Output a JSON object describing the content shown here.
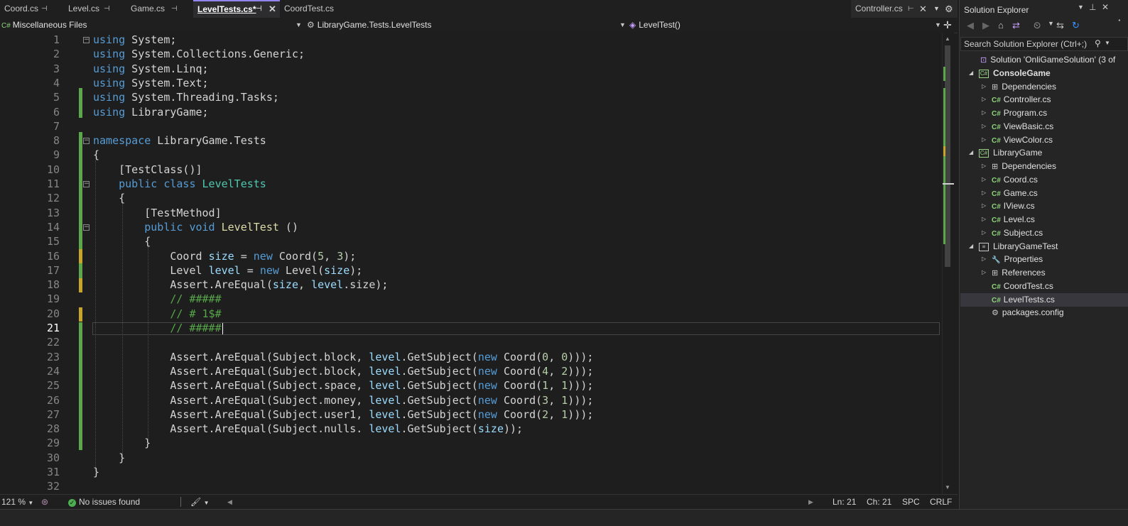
{
  "tabs": [
    {
      "label": "Coord.cs",
      "pinned": true
    },
    {
      "label": "Level.cs",
      "pinned": true
    },
    {
      "label": "Game.cs",
      "pinned": true
    },
    {
      "label": "LevelTests.cs*",
      "pinned": true,
      "active": true
    },
    {
      "label": "CoordTest.cs"
    }
  ],
  "right_tab": {
    "label": "Controller.cs"
  },
  "nav": {
    "project": "Miscellaneous Files",
    "class": "LibraryGame.Tests.LevelTests",
    "member": "LevelTest()"
  },
  "editor": {
    "lines": [
      {
        "n": "1",
        "html": "<span class=\"kw\">using</span> System;"
      },
      {
        "n": "2",
        "html": "<span class=\"kw\">using</span> System.Collections.Generic;"
      },
      {
        "n": "3",
        "html": "<span class=\"kw\">using</span> System.Linq;"
      },
      {
        "n": "4",
        "html": "<span class=\"kw\">using</span> System.Text;"
      },
      {
        "n": "5",
        "html": "<span class=\"kw\">using</span> System.Threading.Tasks;"
      },
      {
        "n": "6",
        "html": "<span class=\"kw\">using</span> LibraryGame;"
      },
      {
        "n": "7",
        "html": ""
      },
      {
        "n": "8",
        "html": "<span class=\"kw\">namespace</span> LibraryGame.Tests"
      },
      {
        "n": "9",
        "html": "{"
      },
      {
        "n": "10",
        "html": "    [TestClass()]"
      },
      {
        "n": "11",
        "html": "    <span class=\"kw\">public</span> <span class=\"kw\">class</span> <span class=\"ty\">LevelTests</span>"
      },
      {
        "n": "12",
        "html": "    {"
      },
      {
        "n": "13",
        "html": "        [TestMethod]"
      },
      {
        "n": "14",
        "html": "        <span class=\"kw\">public</span> <span class=\"kw\">void</span> <span class=\"fn\">LevelTest</span> ()"
      },
      {
        "n": "15",
        "html": "        {"
      },
      {
        "n": "16",
        "html": "            Coord <span class=\"va\">size</span> = <span class=\"kw\">new</span> Coord(<span class=\"nu\">5</span>, <span class=\"nu\">3</span>);"
      },
      {
        "n": "17",
        "html": "            Level <span class=\"va\">level</span> = <span class=\"kw\">new</span> Level(<span class=\"va\">size</span>);"
      },
      {
        "n": "18",
        "html": "            Assert.AreEqual(<span class=\"va\">size</span>, <span class=\"va\">level</span>.size);"
      },
      {
        "n": "19",
        "html": "            <span class=\"cm\">// #####</span>"
      },
      {
        "n": "20",
        "html": "            <span class=\"cm\">// # 1$#</span>"
      },
      {
        "n": "21",
        "html": "            <span class=\"cm\">// #####</span>"
      },
      {
        "n": "22",
        "html": ""
      },
      {
        "n": "23",
        "html": "            Assert.AreEqual(Subject.block, <span class=\"va\">level</span>.GetSubject(<span class=\"kw\">new</span> Coord(<span class=\"nu\">0</span>, <span class=\"nu\">0</span>)));"
      },
      {
        "n": "24",
        "html": "            Assert.AreEqual(Subject.block, <span class=\"va\">level</span>.GetSubject(<span class=\"kw\">new</span> Coord(<span class=\"nu\">4</span>, <span class=\"nu\">2</span>)));"
      },
      {
        "n": "25",
        "html": "            Assert.AreEqual(Subject.space, <span class=\"va\">level</span>.GetSubject(<span class=\"kw\">new</span> Coord(<span class=\"nu\">1</span>, <span class=\"nu\">1</span>)));"
      },
      {
        "n": "26",
        "html": "            Assert.AreEqual(Subject.money, <span class=\"va\">level</span>.GetSubject(<span class=\"kw\">new</span> Coord(<span class=\"nu\">3</span>, <span class=\"nu\">1</span>)));"
      },
      {
        "n": "27",
        "html": "            Assert.AreEqual(Subject.user1, <span class=\"va\">level</span>.GetSubject(<span class=\"kw\">new</span> Coord(<span class=\"nu\">2</span>, <span class=\"nu\">1</span>)));"
      },
      {
        "n": "28",
        "html": "            Assert.AreEqual(Subject.nulls. <span class=\"va\">level</span>.GetSubject(<span class=\"va\">size</span>));"
      },
      {
        "n": "29",
        "html": "        }"
      },
      {
        "n": "30",
        "html": "    }"
      },
      {
        "n": "31",
        "html": "}"
      },
      {
        "n": "32",
        "html": ""
      }
    ],
    "current_line": "21"
  },
  "status": {
    "zoom": "121 %",
    "issues": "No issues found",
    "ln": "Ln: 21",
    "ch": "Ch: 21",
    "spc": "SPC",
    "crlf": "CRLF"
  },
  "solution_explorer": {
    "title": "Solution Explorer",
    "search_placeholder": "Search Solution Explorer (Ctrl+;)",
    "items": [
      {
        "label": "Solution 'OnliGameSolution' (3 of",
        "kind": "solution",
        "level": 0
      },
      {
        "label": "ConsoleGame",
        "kind": "project",
        "level": 1,
        "bold": true,
        "expanded": true
      },
      {
        "label": "Dependencies",
        "kind": "deps",
        "level": 2
      },
      {
        "label": "Controller.cs",
        "kind": "cs",
        "level": 2
      },
      {
        "label": "Program.cs",
        "kind": "cs",
        "level": 2
      },
      {
        "label": "ViewBasic.cs",
        "kind": "cs",
        "level": 2
      },
      {
        "label": "ViewColor.cs",
        "kind": "cs",
        "level": 2
      },
      {
        "label": "LibraryGame",
        "kind": "project",
        "level": 1,
        "expanded": true
      },
      {
        "label": "Dependencies",
        "kind": "deps",
        "level": 2
      },
      {
        "label": "Coord.cs",
        "kind": "cs",
        "level": 2
      },
      {
        "label": "Game.cs",
        "kind": "cs",
        "level": 2
      },
      {
        "label": "IView.cs",
        "kind": "cs",
        "level": 2
      },
      {
        "label": "Level.cs",
        "kind": "cs",
        "level": 2
      },
      {
        "label": "Subject.cs",
        "kind": "cs",
        "level": 2
      },
      {
        "label": "LibraryGameTest",
        "kind": "testproject",
        "level": 1,
        "expanded": true
      },
      {
        "label": "Properties",
        "kind": "props",
        "level": 2
      },
      {
        "label": "References",
        "kind": "deps",
        "level": 2
      },
      {
        "label": "CoordTest.cs",
        "kind": "cs",
        "level": 2,
        "noarrow": true
      },
      {
        "label": "LevelTests.cs",
        "kind": "cs",
        "level": 2,
        "noarrow": true,
        "selected": true
      },
      {
        "label": "packages.config",
        "kind": "config",
        "level": 2,
        "noarrow": true
      }
    ]
  },
  "colors": {
    "keyword": "#569cd6",
    "type": "#4ec9b0",
    "method": "#dcdcaa",
    "variable": "#9cdcfe",
    "number": "#b5cea8",
    "comment": "#57a64a",
    "accent": "#9184ee"
  }
}
